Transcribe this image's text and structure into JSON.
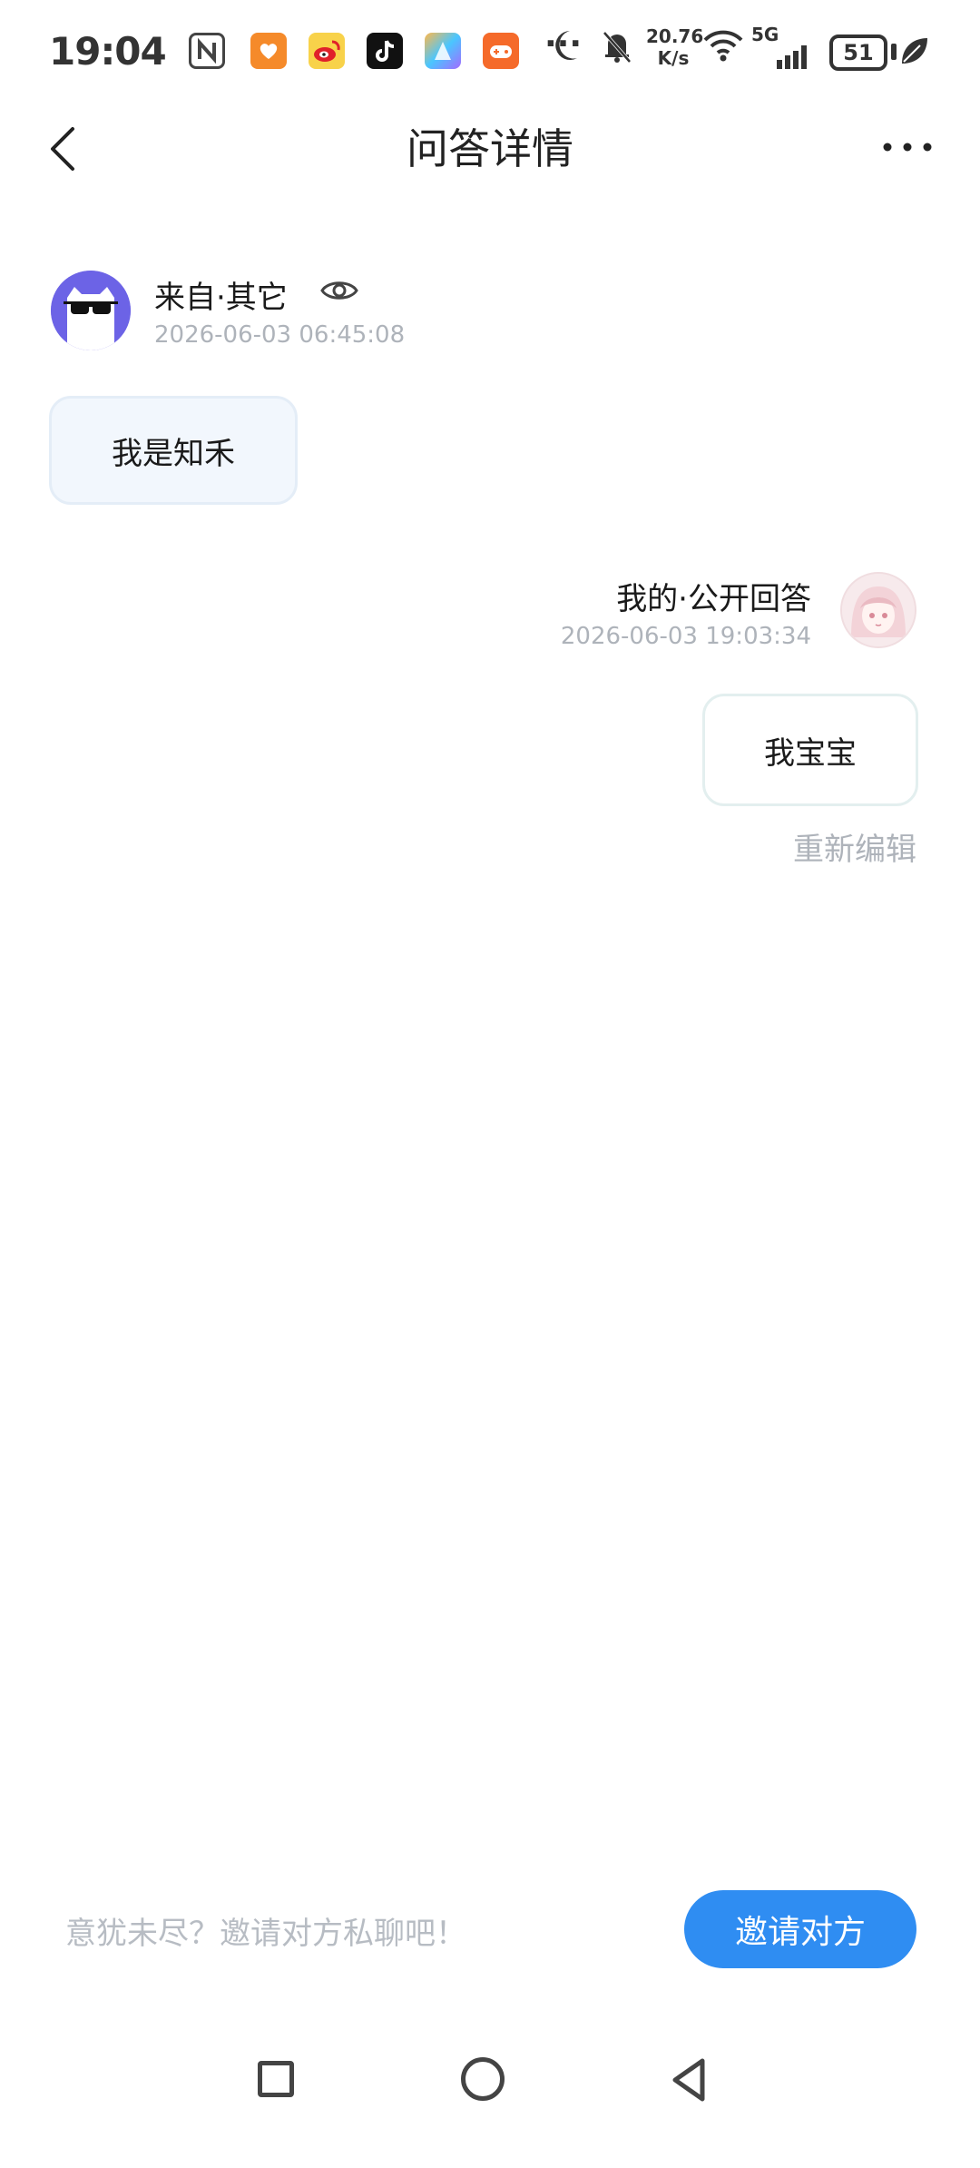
{
  "status_bar": {
    "time": "19:04",
    "ellipsis": "···",
    "net_speed_value": "20.76",
    "net_speed_unit": "K/s",
    "signal": "5G",
    "battery": "51",
    "app_icons": [
      "nfc-icon",
      "app-orange-icon",
      "weibo-icon",
      "tiktok-icon",
      "paint-app-icon",
      "game-app-icon"
    ],
    "right_icons": [
      "moon-icon",
      "mute-bell-icon",
      "wifi-icon",
      "signal-icon",
      "battery-icon",
      "leaf-icon"
    ]
  },
  "header": {
    "title": "问答详情",
    "back_icon": "chevron-left-icon",
    "more_icon": "more-icon"
  },
  "question": {
    "source": "来自·其它",
    "time": "2026-06-03 06:45:08",
    "text": "我是知禾",
    "avatar_color": "#6c63e6"
  },
  "answer": {
    "source": "我的·公开回答",
    "time": "2026-06-03 19:03:34",
    "text": "我宝宝",
    "reedit_label": "重新编辑"
  },
  "footer": {
    "hint": "意犹未尽？邀请对方私聊吧！",
    "invite_label": "邀请对方",
    "accent_color": "#2f8df2"
  }
}
